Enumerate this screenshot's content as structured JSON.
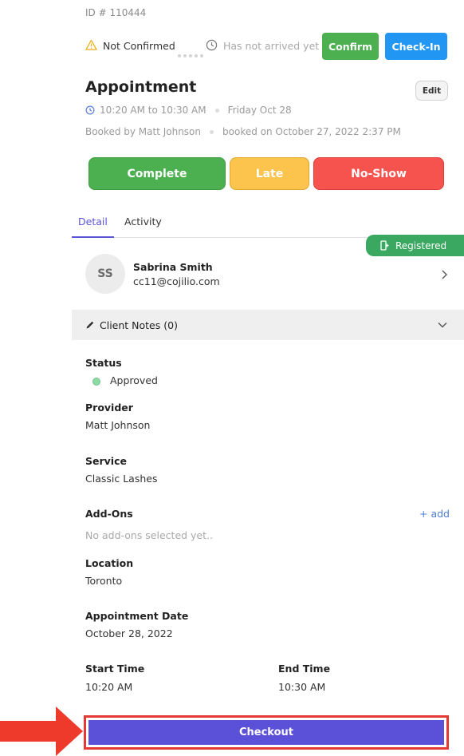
{
  "header": {
    "id_line": "ID # 110444",
    "confirm_status": "Not Confirmed",
    "arrival_status": "Has not arrived yet",
    "confirm_label": "Confirm",
    "checkin_label": "Check-In"
  },
  "appointment": {
    "title": "Appointment",
    "edit_label": "Edit",
    "time_range": "10:20 AM to 10:30 AM",
    "day": "Friday Oct 28",
    "booked_by": "Booked by Matt Johnson",
    "booked_on": "booked on October 27, 2022 2:37 PM"
  },
  "actions": {
    "complete": "Complete",
    "late": "Late",
    "no_show": "No-Show"
  },
  "tabs": {
    "detail": "Detail",
    "activity": "Activity"
  },
  "registered_badge": "Registered",
  "client": {
    "initials": "SS",
    "name": "Sabrina Smith",
    "email": "cc11@cojilio.com"
  },
  "notes": {
    "label": "Client Notes (0)"
  },
  "details": {
    "status_label": "Status",
    "status_value": "Approved",
    "provider_label": "Provider",
    "provider_value": "Matt Johnson",
    "service_label": "Service",
    "service_value": "Classic Lashes",
    "addons_label": "Add-Ons",
    "addons_link": "+ add",
    "addons_empty": "No add-ons selected yet..",
    "location_label": "Location",
    "location_value": "Toronto",
    "date_label": "Appointment Date",
    "date_value": "October 28, 2022",
    "start_label": "Start Time",
    "start_value": "10:20 AM",
    "end_label": "End Time",
    "end_value": "10:30 AM"
  },
  "checkout_label": "Checkout",
  "colors": {
    "accent": "#5b51d8",
    "confirm": "#4caf50",
    "checkin": "#2196f3",
    "late": "#fcc44d",
    "no_show": "#f6534f",
    "registered": "#3aa860",
    "highlight": "#e53935"
  },
  "icons": [
    "warning-icon",
    "clock-icon",
    "registered-icon",
    "chevron-right-icon",
    "pencil-icon",
    "chevron-down-icon",
    "arrow-right-icon"
  ]
}
